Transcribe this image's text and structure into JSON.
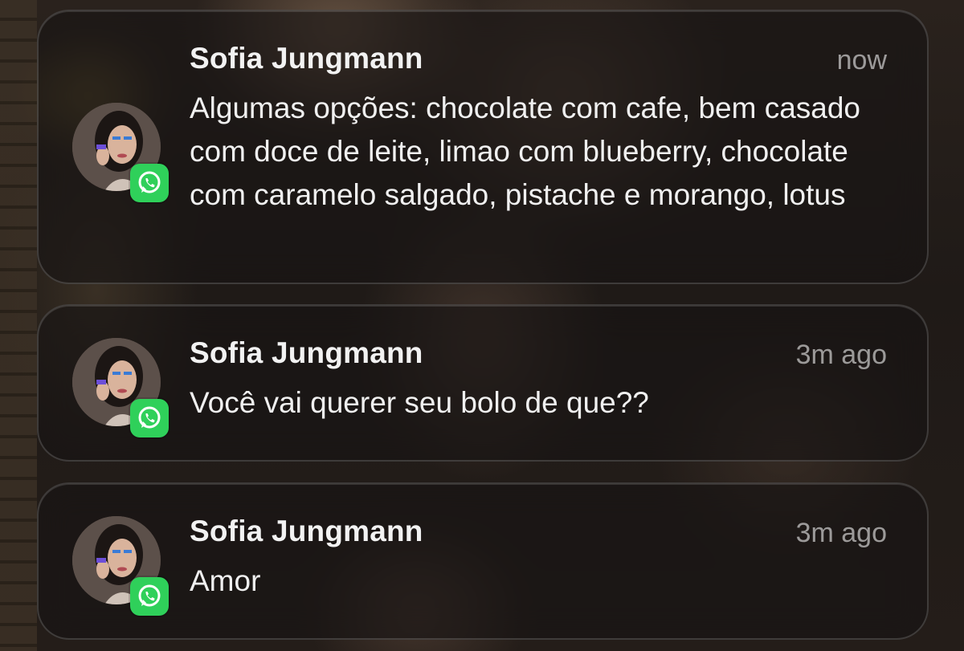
{
  "notifications": [
    {
      "sender": "Sofia Jungmann",
      "time": "now",
      "message": "Algumas opções: chocolate com cafe, bem casado com doce de leite, limao com blueberry, chocolate com caramelo salgado, pistache e morango, lotus",
      "app_icon": "whatsapp-icon"
    },
    {
      "sender": "Sofia Jungmann",
      "time": "3m ago",
      "message": "Você vai querer seu bolo de que??",
      "app_icon": "whatsapp-icon"
    },
    {
      "sender": "Sofia Jungmann",
      "time": "3m ago",
      "message": "Amor",
      "app_icon": "whatsapp-icon"
    }
  ],
  "colors": {
    "whatsapp_green": "#2fd05a",
    "text_primary": "#f0f0f0",
    "text_secondary": "#a8a8a8"
  }
}
